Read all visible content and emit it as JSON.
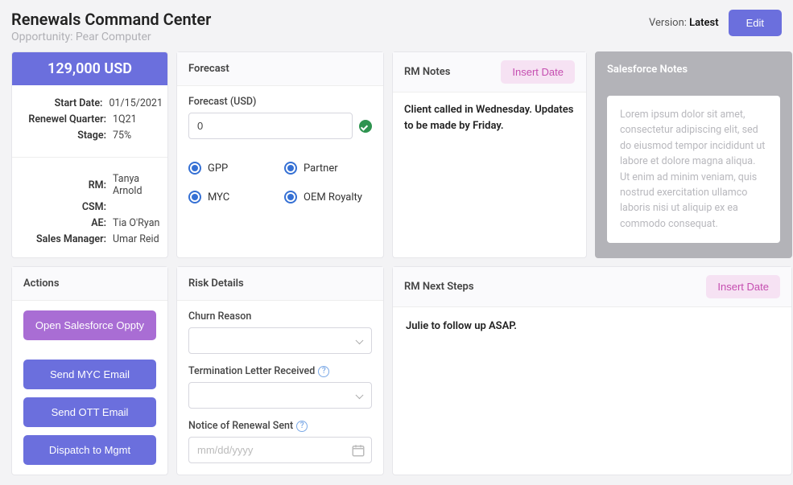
{
  "header": {
    "title": "Renewals Command Center",
    "subtitle": "Opportunity: Pear Computer",
    "version_label": "Version:",
    "version_value": "Latest",
    "edit": "Edit"
  },
  "summary": {
    "amount": "129,000 USD",
    "fields": {
      "start_date_k": "Start Date:",
      "start_date_v": "01/15/2021",
      "renewal_q_k": "Renewel Quarter:",
      "renewal_q_v": "1Q21",
      "stage_k": "Stage:",
      "stage_v": "75%",
      "rm_k": "RM:",
      "rm_v": "Tanya Arnold",
      "csm_k": "CSM:",
      "csm_v": "",
      "ae_k": "AE:",
      "ae_v": "Tia O'Ryan",
      "sm_k": "Sales Manager:",
      "sm_v": "Umar Reid"
    }
  },
  "forecast": {
    "title": "Forecast",
    "label": "Forecast (USD)",
    "value": "0",
    "options": {
      "gpp": "GPP",
      "partner": "Partner",
      "myc": "MYC",
      "oem": "OEM Royalty"
    }
  },
  "rm_notes": {
    "title": "RM Notes",
    "insert_date": "Insert Date",
    "text": "Client called in Wednesday. Updates to be made by Friday."
  },
  "sf_notes": {
    "title": "Salesforce Notes",
    "text": "Lorem ipsum dolor sit amet, consectetur adipiscing elit, sed do eiusmod tempor incididunt ut labore et dolore magna aliqua. Ut enim ad minim veniam, quis nostrud exercitation ullamco laboris nisi ut aliquip ex ea commodo consequat."
  },
  "actions": {
    "title": "Actions",
    "open_sf": "Open Salesforce Oppty",
    "myc": "Send MYC Email",
    "ott": "Send OTT Email",
    "mgmt": "Dispatch to Mgmt"
  },
  "risk": {
    "title": "Risk Details",
    "churn": "Churn Reason",
    "term": "Termination Letter Received",
    "notice": "Notice of Renewal Sent",
    "date_ph": "mm/dd/yyyy"
  },
  "next_steps": {
    "title": "RM Next Steps",
    "insert_date": "Insert Date",
    "text": "Julie to follow up ASAP."
  }
}
